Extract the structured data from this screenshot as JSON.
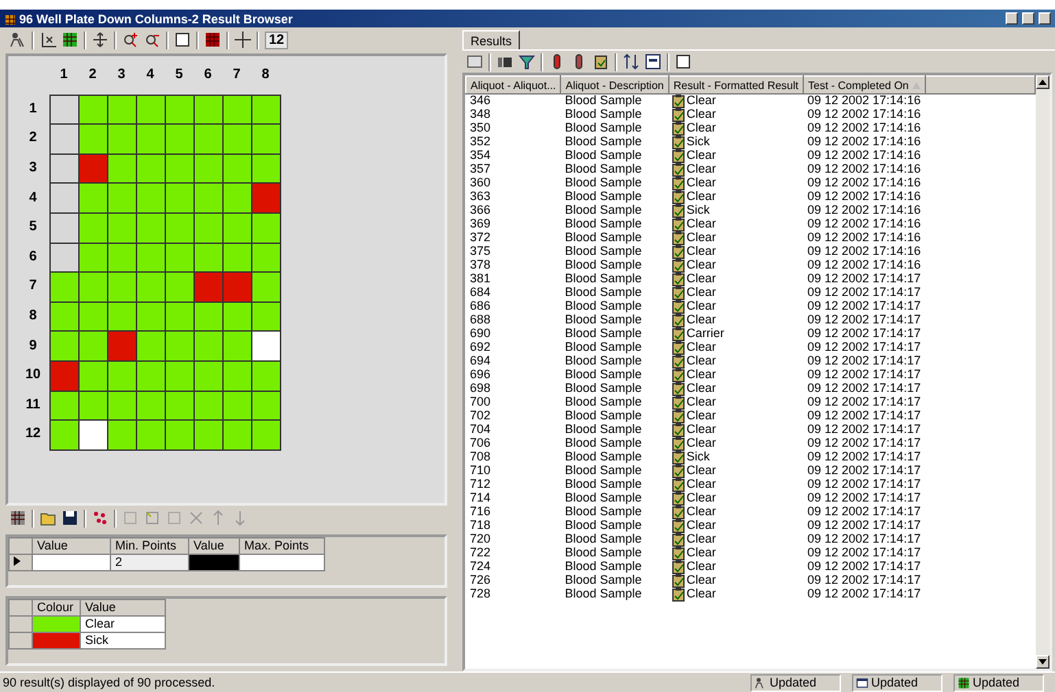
{
  "window": {
    "title": "96 Well Plate Down Columns-2 Result Browser"
  },
  "plate_toolbar": {
    "size_value": "12"
  },
  "plate": {
    "column_labels": [
      "1",
      "2",
      "3",
      "4",
      "5",
      "6",
      "7",
      "8"
    ],
    "rows": [
      {
        "label": "1",
        "wells": [
          {
            "color": "#d8d8d8"
          },
          {
            "color": "#77ee00"
          },
          {
            "color": "#77ee00"
          },
          {
            "color": "#77ee00"
          },
          {
            "color": "#77ee00"
          },
          {
            "color": "#77ee00"
          },
          {
            "color": "#77ee00"
          },
          {
            "color": "#77ee00"
          }
        ]
      },
      {
        "label": "2",
        "wells": [
          {
            "color": "#d8d8d8"
          },
          {
            "color": "#77ee00"
          },
          {
            "color": "#77ee00"
          },
          {
            "color": "#77ee00"
          },
          {
            "color": "#77ee00"
          },
          {
            "color": "#77ee00"
          },
          {
            "color": "#77ee00"
          },
          {
            "color": "#77ee00"
          }
        ]
      },
      {
        "label": "3",
        "wells": [
          {
            "color": "#d8d8d8"
          },
          {
            "color": "#dd1100"
          },
          {
            "color": "#77ee00"
          },
          {
            "color": "#77ee00"
          },
          {
            "color": "#77ee00"
          },
          {
            "color": "#77ee00"
          },
          {
            "color": "#77ee00"
          },
          {
            "color": "#77ee00"
          }
        ]
      },
      {
        "label": "4",
        "wells": [
          {
            "color": "#d8d8d8"
          },
          {
            "color": "#77ee00"
          },
          {
            "color": "#77ee00"
          },
          {
            "color": "#77ee00"
          },
          {
            "color": "#77ee00"
          },
          {
            "color": "#77ee00"
          },
          {
            "color": "#77ee00"
          },
          {
            "color": "#dd1100"
          }
        ]
      },
      {
        "label": "5",
        "wells": [
          {
            "color": "#d8d8d8"
          },
          {
            "color": "#77ee00"
          },
          {
            "color": "#77ee00"
          },
          {
            "color": "#77ee00"
          },
          {
            "color": "#77ee00"
          },
          {
            "color": "#77ee00"
          },
          {
            "color": "#77ee00"
          },
          {
            "color": "#77ee00"
          }
        ]
      },
      {
        "label": "6",
        "wells": [
          {
            "color": "#d8d8d8"
          },
          {
            "color": "#77ee00"
          },
          {
            "color": "#77ee00"
          },
          {
            "color": "#77ee00"
          },
          {
            "color": "#77ee00"
          },
          {
            "color": "#77ee00"
          },
          {
            "color": "#77ee00"
          },
          {
            "color": "#77ee00"
          }
        ]
      },
      {
        "label": "7",
        "wells": [
          {
            "color": "#77ee00"
          },
          {
            "color": "#77ee00"
          },
          {
            "color": "#77ee00"
          },
          {
            "color": "#77ee00"
          },
          {
            "color": "#77ee00"
          },
          {
            "color": "#dd1100"
          },
          {
            "color": "#dd1100"
          },
          {
            "color": "#77ee00"
          }
        ]
      },
      {
        "label": "8",
        "wells": [
          {
            "color": "#77ee00"
          },
          {
            "color": "#77ee00"
          },
          {
            "color": "#77ee00"
          },
          {
            "color": "#77ee00"
          },
          {
            "color": "#77ee00"
          },
          {
            "color": "#77ee00"
          },
          {
            "color": "#77ee00"
          },
          {
            "color": "#77ee00"
          }
        ]
      },
      {
        "label": "9",
        "wells": [
          {
            "color": "#77ee00"
          },
          {
            "color": "#77ee00"
          },
          {
            "color": "#dd1100"
          },
          {
            "color": "#77ee00"
          },
          {
            "color": "#77ee00"
          },
          {
            "color": "#77ee00"
          },
          {
            "color": "#77ee00"
          },
          {
            "color": "#ffffff"
          }
        ]
      },
      {
        "label": "10",
        "wells": [
          {
            "color": "#dd1100"
          },
          {
            "color": "#77ee00"
          },
          {
            "color": "#77ee00"
          },
          {
            "color": "#77ee00"
          },
          {
            "color": "#77ee00"
          },
          {
            "color": "#77ee00"
          },
          {
            "color": "#77ee00"
          },
          {
            "color": "#77ee00"
          }
        ]
      },
      {
        "label": "11",
        "wells": [
          {
            "color": "#77ee00"
          },
          {
            "color": "#77ee00"
          },
          {
            "color": "#77ee00"
          },
          {
            "color": "#77ee00"
          },
          {
            "color": "#77ee00"
          },
          {
            "color": "#77ee00"
          },
          {
            "color": "#77ee00"
          },
          {
            "color": "#77ee00"
          }
        ]
      },
      {
        "label": "12",
        "wells": [
          {
            "color": "#77ee00"
          },
          {
            "color": "#ffffff"
          },
          {
            "color": "#77ee00"
          },
          {
            "color": "#77ee00"
          },
          {
            "color": "#77ee00"
          },
          {
            "color": "#77ee00"
          },
          {
            "color": "#77ee00"
          },
          {
            "color": "#77ee00"
          }
        ]
      }
    ]
  },
  "range_table": {
    "columns": [
      "Value",
      "Min. Points",
      "Value",
      "Max. Points"
    ],
    "rows": [
      {
        "min_points": "2",
        "color": "#000000"
      }
    ]
  },
  "legend": {
    "columns": [
      "Colour",
      "Value"
    ],
    "rows": [
      {
        "color": "#77ee00",
        "value": "Clear"
      },
      {
        "color": "#dd1100",
        "value": "Sick"
      }
    ]
  },
  "results": {
    "tab": "Results",
    "columns": [
      "Aliquot - Aliquot...",
      "Aliquot - Description",
      "Result - Formatted Result",
      "Test - Completed On"
    ],
    "rows": [
      {
        "aliquot": "346",
        "description": "Blood Sample",
        "result": "Clear",
        "completed_on": "09 12 2002 17:14:16"
      },
      {
        "aliquot": "348",
        "description": "Blood Sample",
        "result": "Clear",
        "completed_on": "09 12 2002 17:14:16"
      },
      {
        "aliquot": "350",
        "description": "Blood Sample",
        "result": "Clear",
        "completed_on": "09 12 2002 17:14:16"
      },
      {
        "aliquot": "352",
        "description": "Blood Sample",
        "result": "Sick",
        "completed_on": "09 12 2002 17:14:16"
      },
      {
        "aliquot": "354",
        "description": "Blood Sample",
        "result": "Clear",
        "completed_on": "09 12 2002 17:14:16"
      },
      {
        "aliquot": "357",
        "description": "Blood Sample",
        "result": "Clear",
        "completed_on": "09 12 2002 17:14:16"
      },
      {
        "aliquot": "360",
        "description": "Blood Sample",
        "result": "Clear",
        "completed_on": "09 12 2002 17:14:16"
      },
      {
        "aliquot": "363",
        "description": "Blood Sample",
        "result": "Clear",
        "completed_on": "09 12 2002 17:14:16"
      },
      {
        "aliquot": "366",
        "description": "Blood Sample",
        "result": "Sick",
        "completed_on": "09 12 2002 17:14:16"
      },
      {
        "aliquot": "369",
        "description": "Blood Sample",
        "result": "Clear",
        "completed_on": "09 12 2002 17:14:16"
      },
      {
        "aliquot": "372",
        "description": "Blood Sample",
        "result": "Clear",
        "completed_on": "09 12 2002 17:14:16"
      },
      {
        "aliquot": "375",
        "description": "Blood Sample",
        "result": "Clear",
        "completed_on": "09 12 2002 17:14:16"
      },
      {
        "aliquot": "378",
        "description": "Blood Sample",
        "result": "Clear",
        "completed_on": "09 12 2002 17:14:16"
      },
      {
        "aliquot": "381",
        "description": "Blood Sample",
        "result": "Clear",
        "completed_on": "09 12 2002 17:14:17"
      },
      {
        "aliquot": "684",
        "description": "Blood Sample",
        "result": "Clear",
        "completed_on": "09 12 2002 17:14:17"
      },
      {
        "aliquot": "686",
        "description": "Blood Sample",
        "result": "Clear",
        "completed_on": "09 12 2002 17:14:17"
      },
      {
        "aliquot": "688",
        "description": "Blood Sample",
        "result": "Clear",
        "completed_on": "09 12 2002 17:14:17"
      },
      {
        "aliquot": "690",
        "description": "Blood Sample",
        "result": "Carrier",
        "completed_on": "09 12 2002 17:14:17"
      },
      {
        "aliquot": "692",
        "description": "Blood Sample",
        "result": "Clear",
        "completed_on": "09 12 2002 17:14:17"
      },
      {
        "aliquot": "694",
        "description": "Blood Sample",
        "result": "Clear",
        "completed_on": "09 12 2002 17:14:17"
      },
      {
        "aliquot": "696",
        "description": "Blood Sample",
        "result": "Clear",
        "completed_on": "09 12 2002 17:14:17"
      },
      {
        "aliquot": "698",
        "description": "Blood Sample",
        "result": "Clear",
        "completed_on": "09 12 2002 17:14:17"
      },
      {
        "aliquot": "700",
        "description": "Blood Sample",
        "result": "Clear",
        "completed_on": "09 12 2002 17:14:17"
      },
      {
        "aliquot": "702",
        "description": "Blood Sample",
        "result": "Clear",
        "completed_on": "09 12 2002 17:14:17"
      },
      {
        "aliquot": "704",
        "description": "Blood Sample",
        "result": "Clear",
        "completed_on": "09 12 2002 17:14:17"
      },
      {
        "aliquot": "706",
        "description": "Blood Sample",
        "result": "Clear",
        "completed_on": "09 12 2002 17:14:17"
      },
      {
        "aliquot": "708",
        "description": "Blood Sample",
        "result": "Sick",
        "completed_on": "09 12 2002 17:14:17"
      },
      {
        "aliquot": "710",
        "description": "Blood Sample",
        "result": "Clear",
        "completed_on": "09 12 2002 17:14:17"
      },
      {
        "aliquot": "712",
        "description": "Blood Sample",
        "result": "Clear",
        "completed_on": "09 12 2002 17:14:17"
      },
      {
        "aliquot": "714",
        "description": "Blood Sample",
        "result": "Clear",
        "completed_on": "09 12 2002 17:14:17"
      },
      {
        "aliquot": "716",
        "description": "Blood Sample",
        "result": "Clear",
        "completed_on": "09 12 2002 17:14:17"
      },
      {
        "aliquot": "718",
        "description": "Blood Sample",
        "result": "Clear",
        "completed_on": "09 12 2002 17:14:17"
      },
      {
        "aliquot": "720",
        "description": "Blood Sample",
        "result": "Clear",
        "completed_on": "09 12 2002 17:14:17"
      },
      {
        "aliquot": "722",
        "description": "Blood Sample",
        "result": "Clear",
        "completed_on": "09 12 2002 17:14:17"
      },
      {
        "aliquot": "724",
        "description": "Blood Sample",
        "result": "Clear",
        "completed_on": "09 12 2002 17:14:17"
      },
      {
        "aliquot": "726",
        "description": "Blood Sample",
        "result": "Clear",
        "completed_on": "09 12 2002 17:14:17"
      },
      {
        "aliquot": "728",
        "description": "Blood Sample",
        "result": "Clear",
        "completed_on": "09 12 2002 17:14:17"
      }
    ]
  },
  "status_bar": {
    "message": "90 result(s) displayed of 90 processed.",
    "panels": [
      "Updated",
      "Updated",
      "Updated"
    ]
  }
}
